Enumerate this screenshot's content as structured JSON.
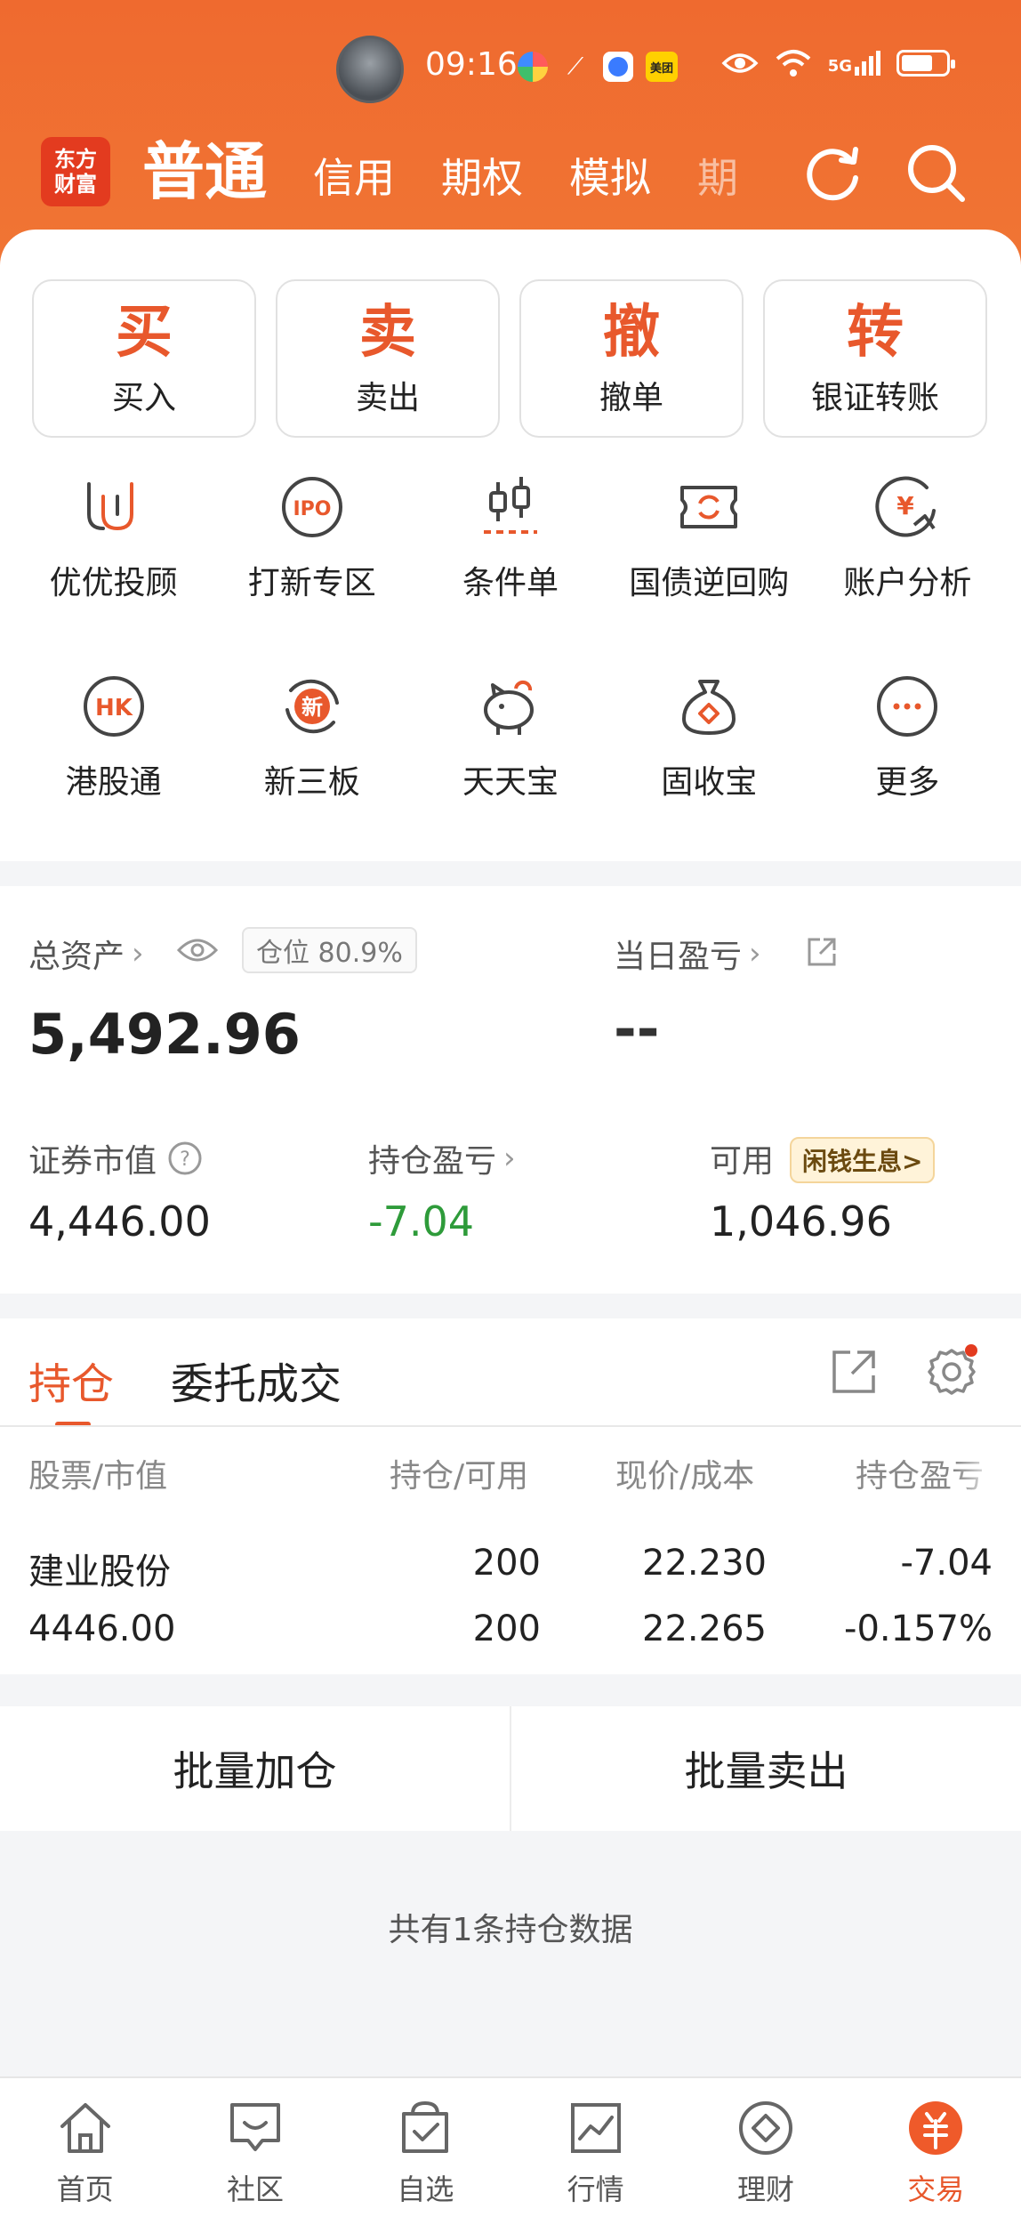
{
  "status_bar": {
    "time": "09:16",
    "meituan_label": "美团",
    "network": "5G",
    "colors": {
      "accent": "#e8582c",
      "header": "#ef6a2f",
      "gain_loss": "#2e9b3a"
    }
  },
  "header": {
    "logo_text": "东方财富",
    "tabs": [
      {
        "label": "普通",
        "active": true
      },
      {
        "label": "信用",
        "active": false
      },
      {
        "label": "期权",
        "active": false
      },
      {
        "label": "模拟",
        "active": false
      },
      {
        "label": "期",
        "active": false
      }
    ]
  },
  "quick_actions": [
    {
      "glyph": "买",
      "label": "买入"
    },
    {
      "glyph": "卖",
      "label": "卖出"
    },
    {
      "glyph": "撤",
      "label": "撤单"
    },
    {
      "glyph": "转",
      "label": "银证转账"
    }
  ],
  "services": [
    {
      "label": "优优投顾",
      "icon": "uu-icon"
    },
    {
      "label": "打新专区",
      "icon": "ipo-icon"
    },
    {
      "label": "条件单",
      "icon": "candlestick-icon"
    },
    {
      "label": "国债逆回购",
      "icon": "refresh-ticket-icon"
    },
    {
      "label": "账户分析",
      "icon": "yuan-chat-icon"
    },
    {
      "label": "港股通",
      "icon": "hk-icon"
    },
    {
      "label": "新三板",
      "icon": "new-board-icon"
    },
    {
      "label": "天天宝",
      "icon": "piggy-bank-icon"
    },
    {
      "label": "固收宝",
      "icon": "money-bag-icon"
    },
    {
      "label": "更多",
      "icon": "more-icon"
    }
  ],
  "assets": {
    "total_label": "总资产",
    "position_label": "仓位 80.9%",
    "total_value": "5,492.96",
    "daily_pnl_label": "当日盈亏",
    "daily_pnl_value": "--",
    "market_value_label": "证券市值",
    "market_value": "4,446.00",
    "holding_pnl_label": "持仓盈亏",
    "holding_pnl": "-7.04",
    "available_label": "可用",
    "available": "1,046.96",
    "promo_label": "闲钱生息>"
  },
  "holdings": {
    "tabs": [
      "持仓",
      "委托成交"
    ],
    "columns": [
      "股票/市值",
      "持仓/可用",
      "现价/成本",
      "持仓盈亏"
    ],
    "rows": [
      {
        "name": "建业股份",
        "market_value": "4446.00",
        "position": "200",
        "available": "200",
        "price": "22.230",
        "cost": "22.265",
        "pnl": "-7.04",
        "pnl_pct": "-0.157%"
      }
    ]
  },
  "batch": {
    "add_label": "批量加仓",
    "sell_label": "批量卖出"
  },
  "footer_text": "共有1条持仓数据",
  "bottom_nav": [
    {
      "label": "首页",
      "icon": "home-icon",
      "active": false
    },
    {
      "label": "社区",
      "icon": "community-icon",
      "active": false
    },
    {
      "label": "自选",
      "icon": "watchlist-icon",
      "active": false
    },
    {
      "label": "行情",
      "icon": "market-icon",
      "active": false
    },
    {
      "label": "理财",
      "icon": "wealth-icon",
      "active": false
    },
    {
      "label": "交易",
      "icon": "trade-icon",
      "active": true
    }
  ]
}
